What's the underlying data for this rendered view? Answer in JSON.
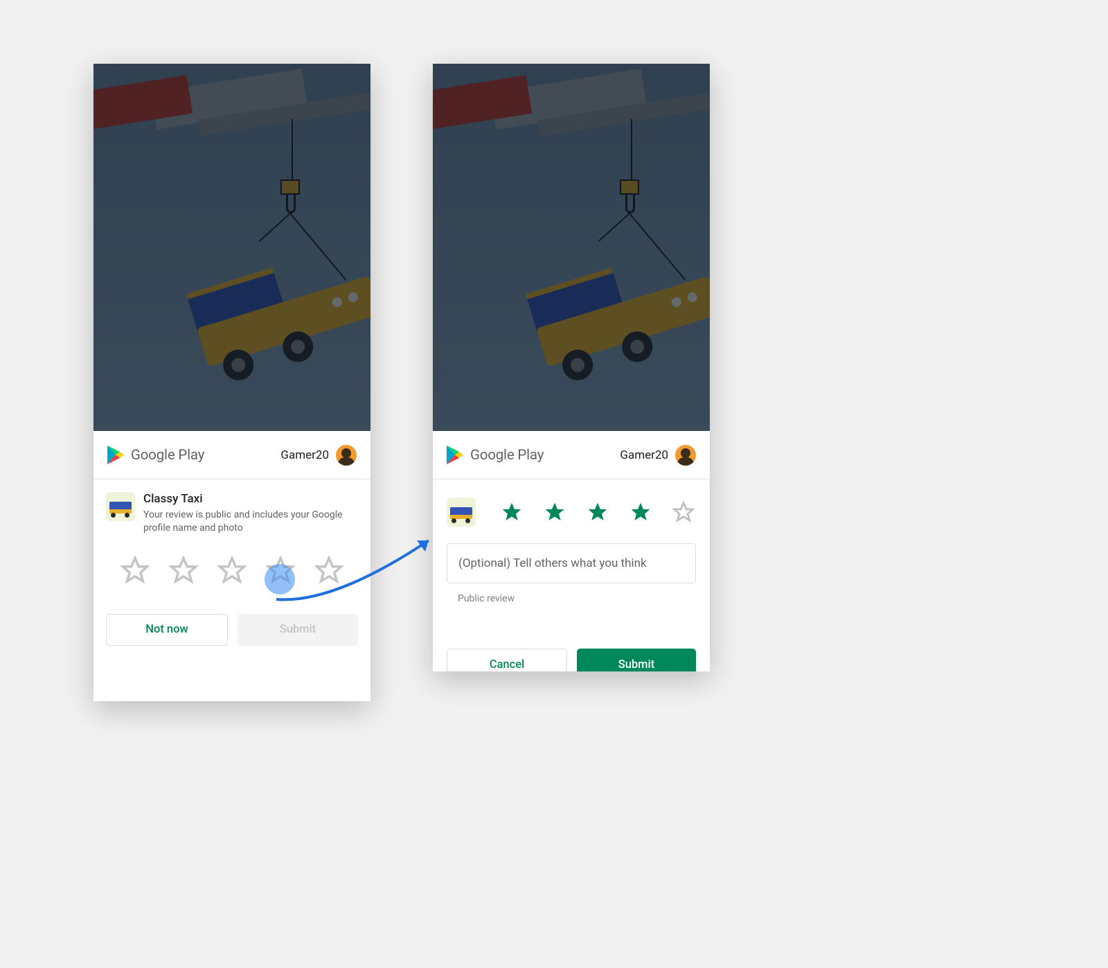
{
  "store": {
    "name": "Google Play"
  },
  "user": {
    "name": "Gamer20"
  },
  "app": {
    "name": "Classy Taxi"
  },
  "screen1": {
    "disclosure": "Your review is public and includes your Google profile name and photo",
    "rating": 0,
    "buttons": {
      "not_now": "Not now",
      "submit": "Submit"
    }
  },
  "screen2": {
    "rating": 4,
    "review_placeholder": "(Optional) Tell others what you think",
    "visibility_label": "Public review",
    "buttons": {
      "cancel": "Cancel",
      "submit": "Submit"
    }
  }
}
